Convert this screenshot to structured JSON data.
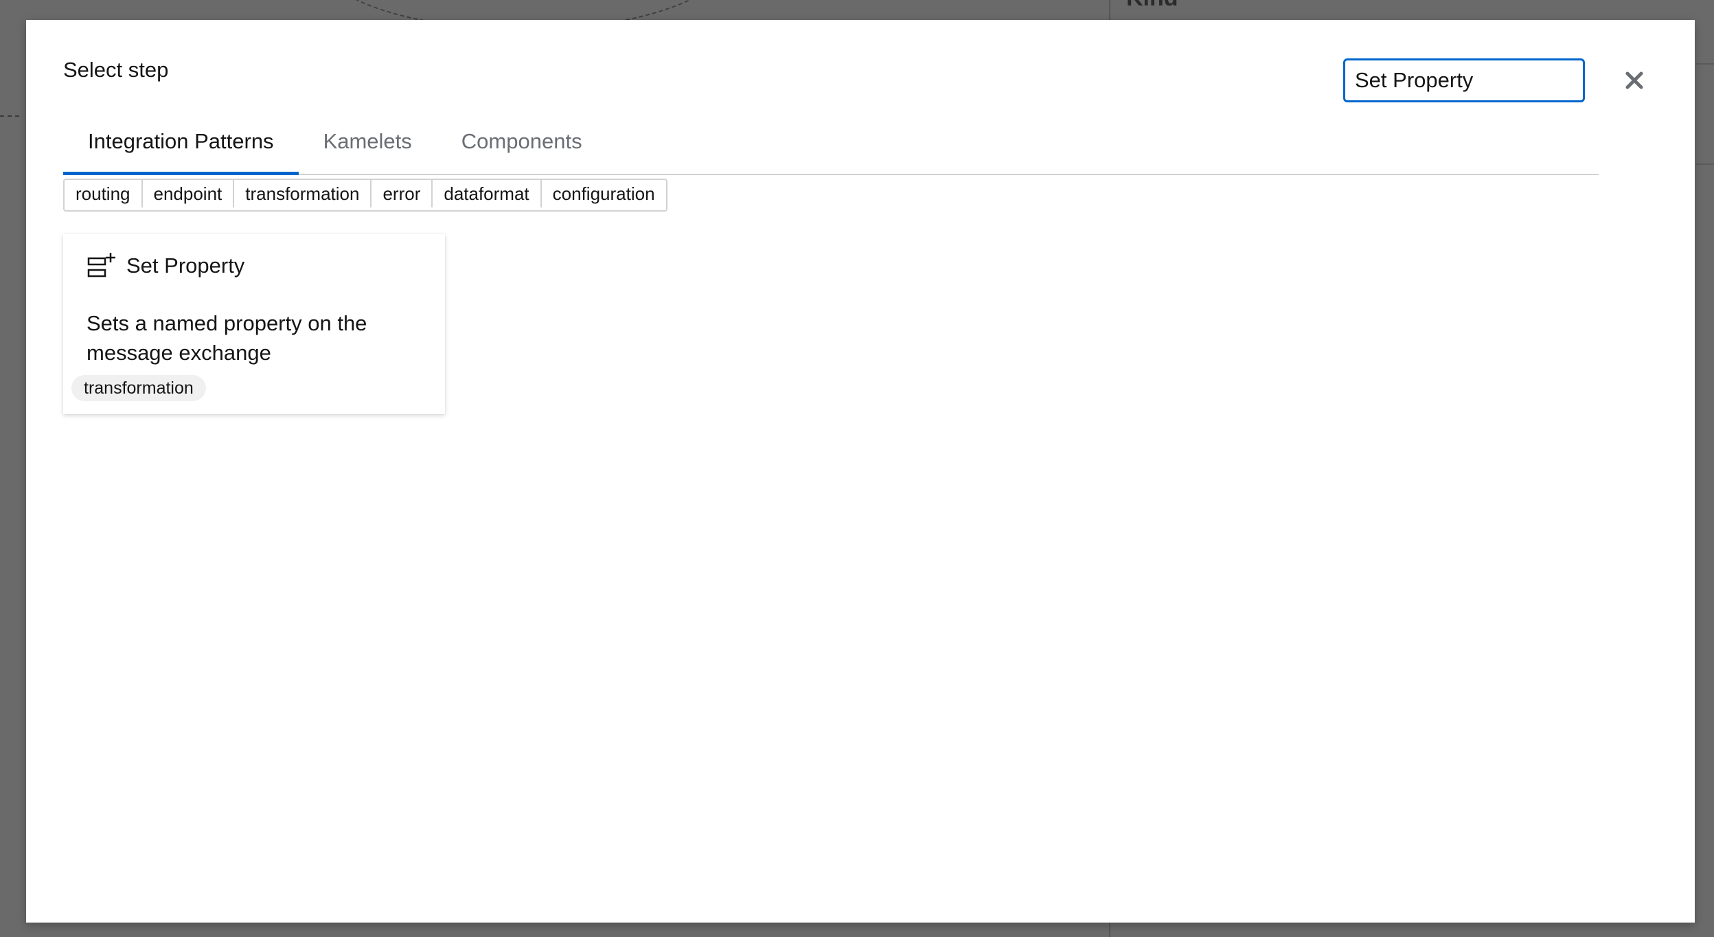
{
  "background": {
    "panel_text": "Kind"
  },
  "modal": {
    "title": "Select step",
    "search": {
      "value": "Set Property",
      "placeholder": ""
    },
    "close_icon": "close-icon",
    "tabs": [
      {
        "label": "Integration Patterns",
        "active": true
      },
      {
        "label": "Kamelets",
        "active": false
      },
      {
        "label": "Components",
        "active": false
      }
    ],
    "filters": [
      "routing",
      "endpoint",
      "transformation",
      "error",
      "dataformat",
      "configuration"
    ],
    "cards": [
      {
        "title": "Set Property",
        "icon": "set-property-icon",
        "description": "Sets a named property on the message exchange",
        "label": "transformation"
      }
    ]
  },
  "colors": {
    "accent": "#0066cc",
    "backdrop": "#6a6a6a",
    "text": "#151515",
    "muted_text": "#6a6e73",
    "border": "#d2d2d2",
    "label_bg": "#f0f0f0"
  }
}
